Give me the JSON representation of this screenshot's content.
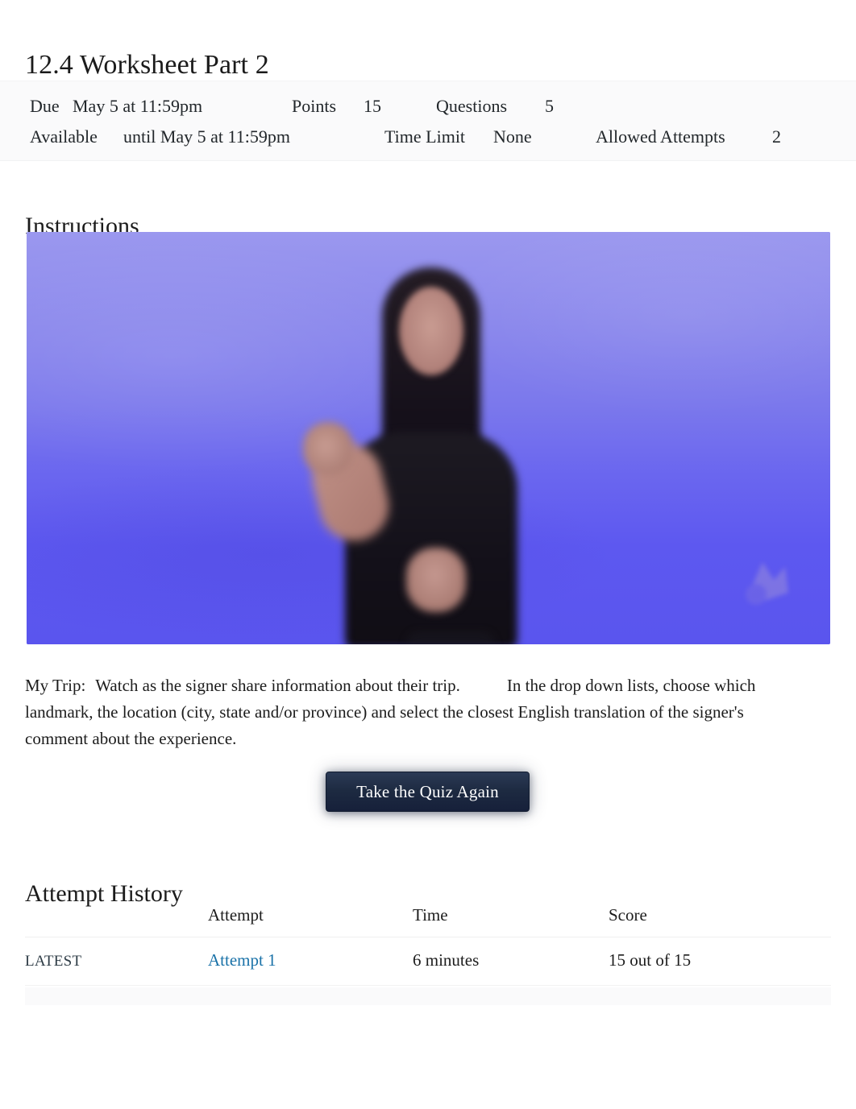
{
  "quiz": {
    "title": "12.4 Worksheet Part 2"
  },
  "meta": {
    "due_label": "Due",
    "due_value": "May 5 at 11:59pm",
    "points_label": "Points",
    "points_value": "15",
    "questions_label": "Questions",
    "questions_value": "5",
    "available_label": "Available",
    "available_value": "until May 5 at 11:59pm",
    "time_limit_label": "Time Limit",
    "time_limit_value": "None",
    "allowed_attempts_label": "Allowed Attempts",
    "allowed_attempts_value": "2"
  },
  "instructions": {
    "heading": "Instructions",
    "video": {
      "alt": "ASL signer video thumbnail",
      "play_icon": "play-button-overlay-icon",
      "watermark_icon": "video-watermark-icon",
      "background_color": "#6f6ef0"
    },
    "paragraph": {
      "part1": "My Trip:",
      "part2": "Watch as the signer share information about their trip.",
      "part3": "In the drop down lists, choose which landmark, the location (city, state and/or province) and select the closest English translation of the signer's comment about the experience."
    }
  },
  "actions": {
    "take_quiz_again": "Take the Quiz Again"
  },
  "attempt_history": {
    "heading": "Attempt History",
    "columns": {
      "kept": "",
      "attempt": "Attempt",
      "time": "Time",
      "score": "Score"
    },
    "rows": [
      {
        "kept": "LATEST",
        "attempt": "Attempt 1",
        "time": "6 minutes",
        "score": "15 out of 15"
      }
    ]
  },
  "colors": {
    "link": "#1a72a8",
    "button_bg": "#1d2a41",
    "meta_bg": "#fafafb"
  }
}
